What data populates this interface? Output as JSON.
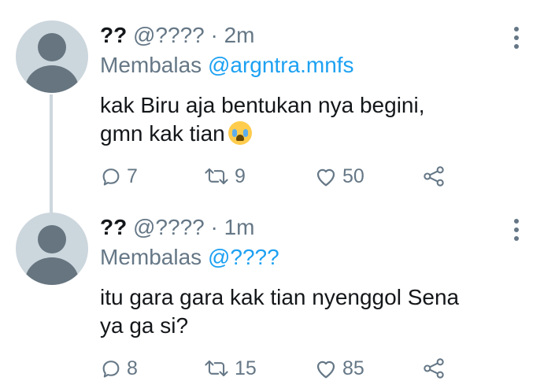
{
  "tweets": [
    {
      "name": "??",
      "handle": "@????",
      "time": "· 2m",
      "reply_prefix": "Membalas",
      "reply_to": "@argntra.mnfs",
      "text_line1": "kak Biru aja bentukan nya begini,",
      "text_line2": "gmn kak tian",
      "emoji": "loudly-crying-face",
      "replies": "7",
      "retweets": "9",
      "likes": "50"
    },
    {
      "name": "??",
      "handle": "@????",
      "time": "· 1m",
      "reply_prefix": "Membalas",
      "reply_to": "@????",
      "text_line1": "itu gara gara kak tian nyenggol Sena",
      "text_line2": "ya ga si?",
      "replies": "8",
      "retweets": "15",
      "likes": "85"
    }
  ],
  "colors": {
    "text": "#14171a",
    "muted": "#657786",
    "link": "#1da1f2",
    "avatar_bg": "#ccd6dd"
  }
}
